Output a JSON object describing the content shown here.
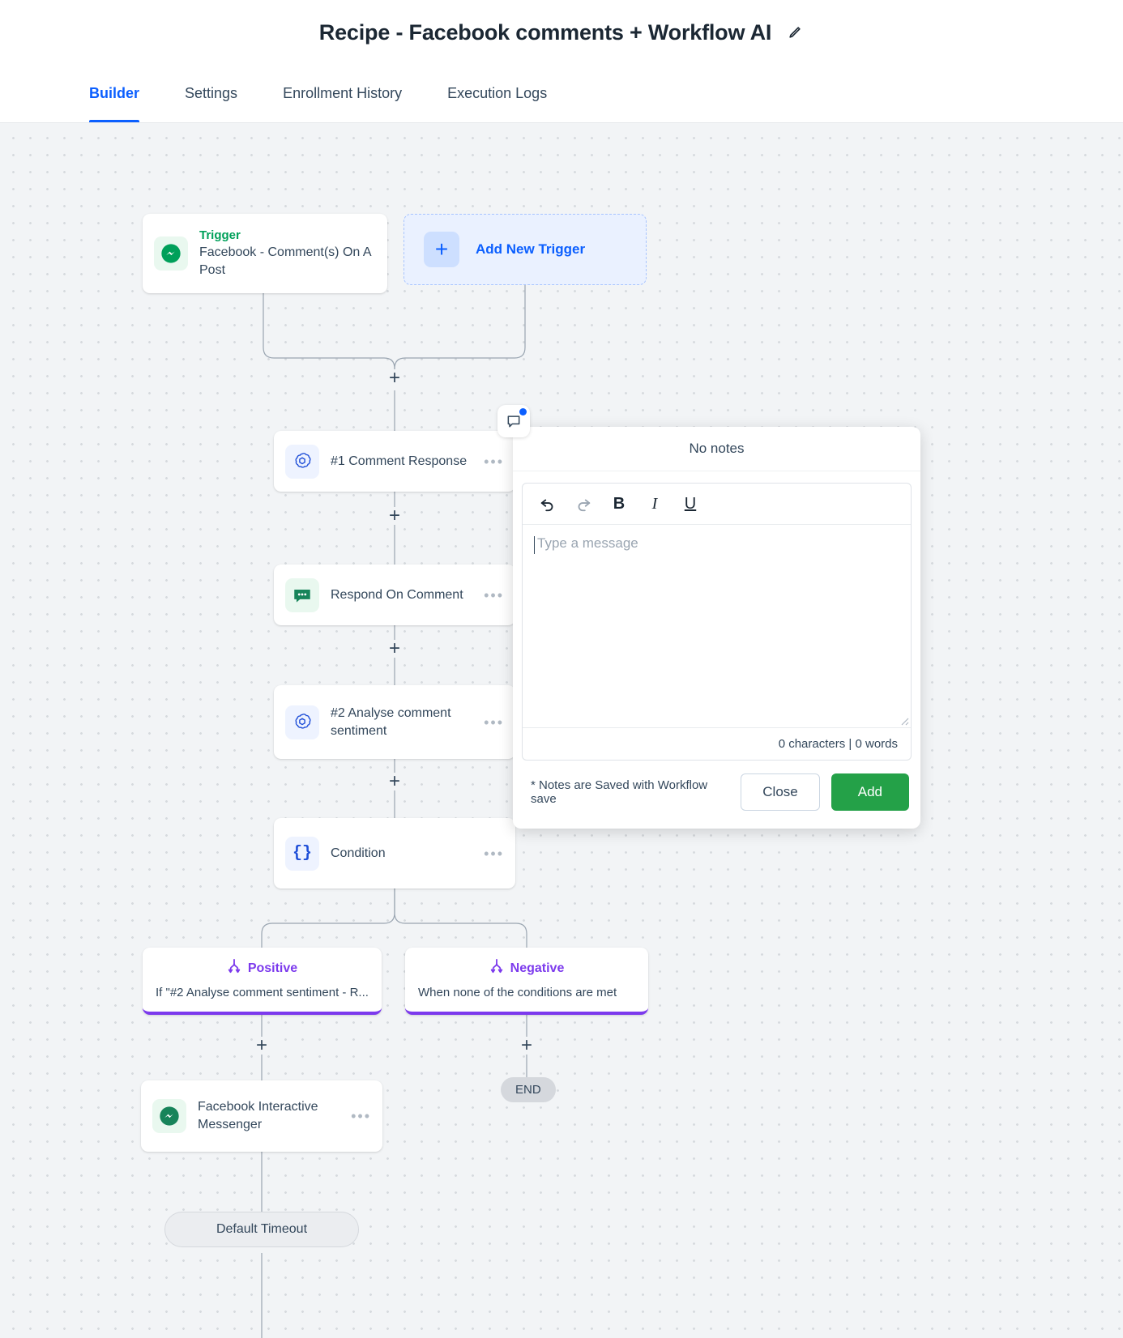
{
  "header": {
    "title": "Recipe - Facebook comments + Workflow AI",
    "edit_icon": "pencil-icon"
  },
  "tabs": [
    {
      "label": "Builder",
      "active": true
    },
    {
      "label": "Settings",
      "active": false
    },
    {
      "label": "Enrollment History",
      "active": false
    },
    {
      "label": "Execution Logs",
      "active": false
    }
  ],
  "canvas": {
    "trigger": {
      "kicker": "Trigger",
      "title": "Facebook - Comment(s) On A Post",
      "icon": "messenger-icon"
    },
    "add_trigger": {
      "label": "Add New Trigger",
      "plus": "+",
      "icon": "plus-icon"
    },
    "steps": [
      {
        "title": "#1 Comment Response",
        "icon": "openai-icon",
        "menu": "•••"
      },
      {
        "title": "Respond On Comment",
        "icon": "comment-bubble-icon",
        "menu": "•••"
      },
      {
        "title": "#2 Analyse comment sentiment",
        "icon": "openai-icon",
        "menu": "•••"
      },
      {
        "title": "Condition",
        "icon": "braces-icon",
        "menu": "•••"
      }
    ],
    "branches": [
      {
        "label": "Positive",
        "desc": "If \"#2 Analyse comment sentiment - R...",
        "icon": "branch-fork-icon"
      },
      {
        "label": "Negative",
        "desc": "When none of the conditions are met",
        "icon": "branch-fork-icon"
      }
    ],
    "positive_step": {
      "title": "Facebook Interactive Messenger",
      "icon": "messenger-icon",
      "menu": "•••"
    },
    "end_label": "END",
    "timeout_label": "Default Timeout",
    "plus_symbol": "+"
  },
  "notes": {
    "badge_icon": "note-bubble-icon",
    "header": "No notes",
    "toolbar": {
      "undo": "undo-icon",
      "redo": "redo-icon",
      "bold": "B",
      "italic": "I",
      "underline": "U"
    },
    "placeholder": "Type a message",
    "counter": "0 characters | 0 words",
    "footnote": "* Notes are Saved with Workflow save",
    "close_label": "Close",
    "add_label": "Add"
  },
  "colors": {
    "accent_blue": "#0b5fff",
    "branch_purple": "#7c3aed",
    "trigger_green": "#00a05a",
    "add_green": "#24a148"
  }
}
